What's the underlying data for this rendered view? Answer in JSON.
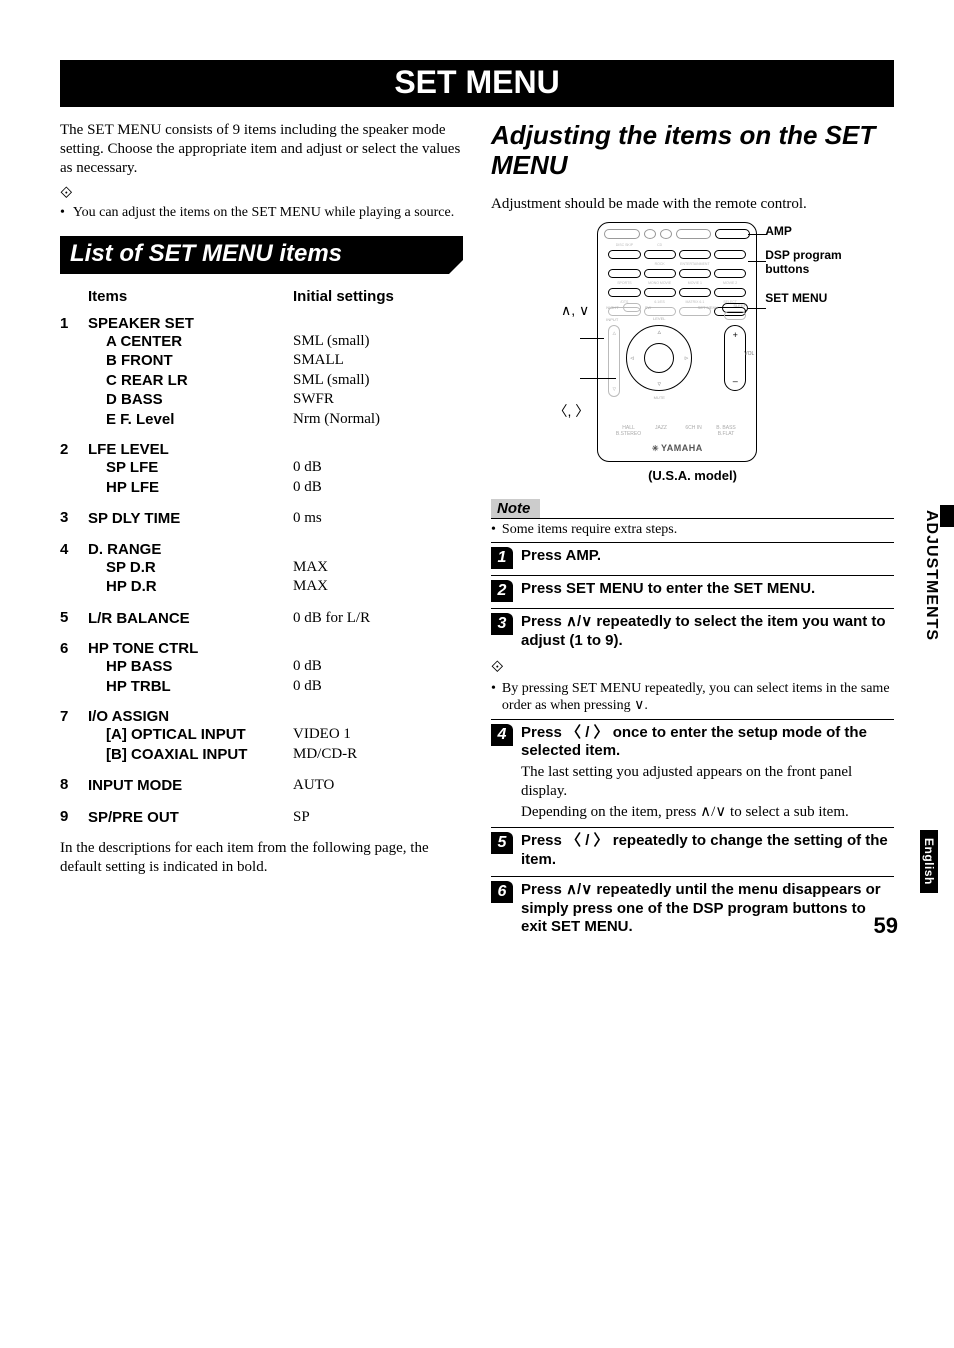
{
  "page_number": "59",
  "side_tab": "ADJUSTMENTS",
  "side_lang": "English",
  "title": "SET MENU",
  "left": {
    "intro": "The SET MENU consists of 9 items including the speaker mode setting. Choose the appropriate item and adjust or select the values as necessary.",
    "hint_bullet": "You can adjust the items on the SET MENU while playing a source.",
    "heading": "List of SET MENU items",
    "header_items": "Items",
    "header_initial": "Initial settings",
    "items": [
      {
        "num": "1",
        "title": "SPEAKER SET",
        "subs": [
          {
            "label": "A CENTER",
            "value": "SML (small)"
          },
          {
            "label": "B FRONT",
            "value": "SMALL"
          },
          {
            "label": "C REAR LR",
            "value": "SML (small)"
          },
          {
            "label": "D BASS",
            "value": "SWFR"
          },
          {
            "label": "E F. Level",
            "value": "Nrm (Normal)"
          }
        ]
      },
      {
        "num": "2",
        "title": "LFE LEVEL",
        "subs": [
          {
            "label": "SP LFE",
            "value": "0 dB"
          },
          {
            "label": "HP LFE",
            "value": "0 dB"
          }
        ]
      },
      {
        "num": "3",
        "title": "SP DLY TIME",
        "single_value": "0 ms"
      },
      {
        "num": "4",
        "title": "D. RANGE",
        "subs": [
          {
            "label": "SP D.R",
            "value": "MAX"
          },
          {
            "label": "HP D.R",
            "value": "MAX"
          }
        ]
      },
      {
        "num": "5",
        "title": "L/R BALANCE",
        "single_value": "0 dB for L/R"
      },
      {
        "num": "6",
        "title": "HP TONE CTRL",
        "subs": [
          {
            "label": "HP BASS",
            "value": "0 dB"
          },
          {
            "label": "HP TRBL",
            "value": "0 dB"
          }
        ]
      },
      {
        "num": "7",
        "title": "I/O ASSIGN",
        "subs": [
          {
            "label": "[A] OPTICAL INPUT",
            "value": "VIDEO 1"
          },
          {
            "label": "[B] COAXIAL INPUT",
            "value": "MD/CD-R"
          }
        ]
      },
      {
        "num": "8",
        "title": "INPUT MODE",
        "single_value": "AUTO"
      },
      {
        "num": "9",
        "title": "SP/PRE OUT",
        "single_value": "SP"
      }
    ],
    "closing": "In the descriptions for each item from the following page, the default setting is indicated in bold."
  },
  "right": {
    "heading1": "Adjusting the items on the SET",
    "heading2": "MENU",
    "intro": "Adjustment should be made with the remote control.",
    "remote_labels": {
      "amp": "AMP",
      "dsp1": "DSP program",
      "dsp2": "buttons",
      "setmenu": "SET MENU",
      "updown": "∧, ∨",
      "leftright": "〈, 〉",
      "logo": "YAMAHA"
    },
    "model_caption": "(U.S.A. model)",
    "note_label": "Note",
    "note_text": "Some items require extra steps.",
    "steps": [
      {
        "n": "1",
        "text": "Press AMP."
      },
      {
        "n": "2",
        "text": "Press SET MENU to enter the SET MENU."
      },
      {
        "n": "3",
        "text_pre": "Press ",
        "sym": "∧/∨",
        "text_post": " repeatedly to select the item you want to adjust (1 to 9)."
      }
    ],
    "hint_bullet": "By pressing SET MENU repeatedly, you can select items in the same order as when pressing ∨.",
    "steps2": [
      {
        "n": "4",
        "text_pre": "Press ",
        "sym": "〈 / 〉",
        "text_post": " once to enter the setup mode of the selected item.",
        "sub1": "The last setting you adjusted appears on the front panel display.",
        "sub2_pre": "Depending on the item, press ",
        "sub2_sym": "∧/∨",
        "sub2_post": " to select a sub item."
      },
      {
        "n": "5",
        "text_pre": "Press ",
        "sym": "〈 / 〉",
        "text_post": " repeatedly to change the setting of the item."
      },
      {
        "n": "6",
        "text_pre": "Press ",
        "sym": "∧/∨",
        "text_post": " repeatedly until the menu disappears or simply press one of the DSP program buttons to exit SET MENU."
      }
    ]
  }
}
